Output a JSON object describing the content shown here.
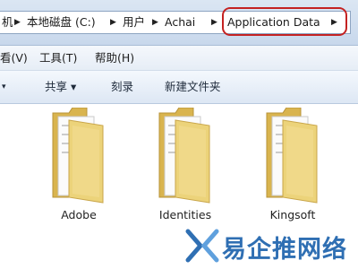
{
  "address": {
    "breadcrumbs": [
      "机",
      "本地磁盘 (C:)",
      "用户",
      "Achai",
      "Application Data"
    ]
  },
  "menubar": {
    "items": [
      "看(V)",
      "工具(T)",
      "帮助(H)"
    ]
  },
  "toolbar": {
    "share_label": "共享 ▾",
    "burn_label": "刻录",
    "new_folder_label": "新建文件夹"
  },
  "folders": [
    {
      "name": "Adobe"
    },
    {
      "name": "Identities"
    },
    {
      "name": "Kingsoft"
    }
  ],
  "watermark": {
    "text": "易企推网络",
    "color": "#2f6fb3"
  },
  "colors": {
    "highlight": "#c42222",
    "folder": "#e8c86a"
  }
}
